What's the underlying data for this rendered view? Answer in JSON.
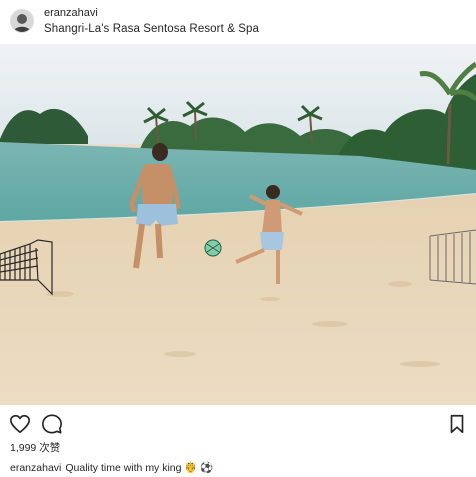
{
  "post": {
    "username": "eranzahavi",
    "location": "Shangri-La's Rasa Sentosa Resort & Spa",
    "likes": "1,999 次赞",
    "caption_user": "eranzahavi",
    "caption_text": "Quality time with my king 🤴 ⚽"
  },
  "icons": {
    "like": "heart-icon",
    "comment": "comment-icon",
    "save": "bookmark-icon",
    "avatar": "user-avatar"
  },
  "colors": {
    "text": "#262626",
    "sky": "#e8eef2",
    "sea": "#6fb2ae",
    "sand": "#e8d5b7"
  }
}
